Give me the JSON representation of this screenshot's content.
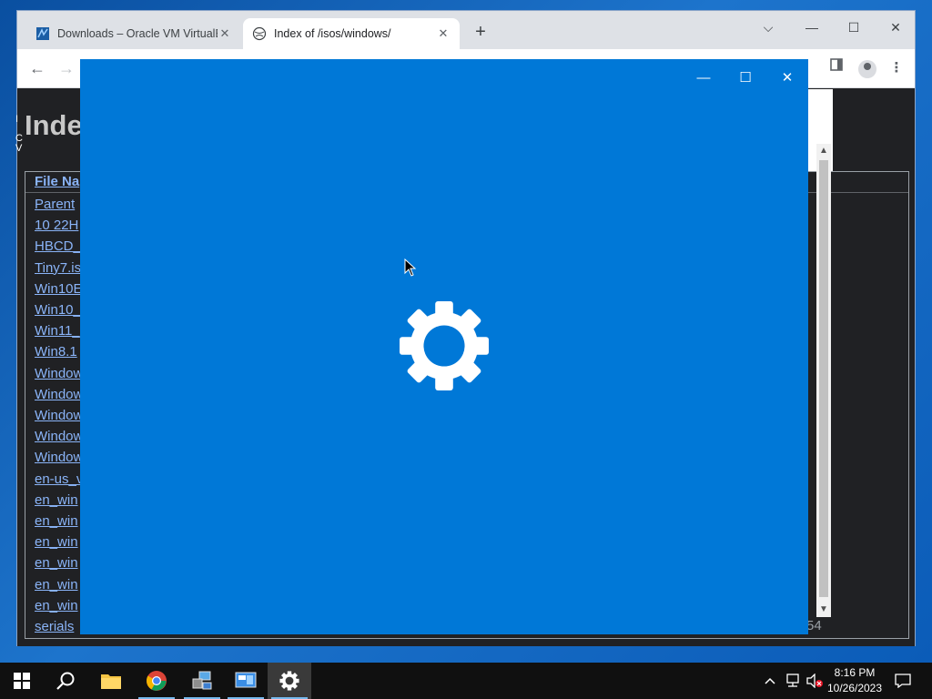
{
  "browser": {
    "tabs": [
      {
        "title": "Downloads – Oracle VM VirtualBo",
        "close": "✕"
      },
      {
        "title": "Index of /isos/windows/",
        "close": "✕"
      }
    ],
    "new_tab": "+",
    "window_controls": {
      "dropdown": "⌵",
      "minimize": "—",
      "maximize": "☐",
      "close": "✕"
    },
    "nav": {
      "back": "←",
      "forward": "→"
    }
  },
  "page": {
    "heading": "Inde",
    "side_text": [
      "I",
      "C",
      "V"
    ],
    "table": {
      "header": "File Na",
      "rows": [
        "Parent",
        "10 22H",
        "HBCD_",
        "Tiny7.is",
        "Win10E",
        "Win10_",
        "Win11_",
        "Win8.1",
        "Window",
        "Window",
        "Window",
        "Window",
        "Window",
        "en-us_v",
        "en_win",
        "en_win",
        "en_win",
        "en_win",
        "en_win",
        "en_win",
        "serials"
      ],
      "last_size": "54"
    }
  },
  "settings_window": {
    "controls": {
      "minimize": "—",
      "maximize": "☐",
      "close": "✕"
    },
    "accent": "#0078d7",
    "icon": "gear-icon"
  },
  "taskbar": {
    "items": [
      "windows-start",
      "search",
      "file-explorer",
      "chrome",
      "network-tool",
      "control-panel",
      "settings"
    ],
    "tray": {
      "chevron": "^",
      "volume_muted": true
    },
    "clock": {
      "time": "8:16 PM",
      "date": "10/26/2023"
    }
  }
}
